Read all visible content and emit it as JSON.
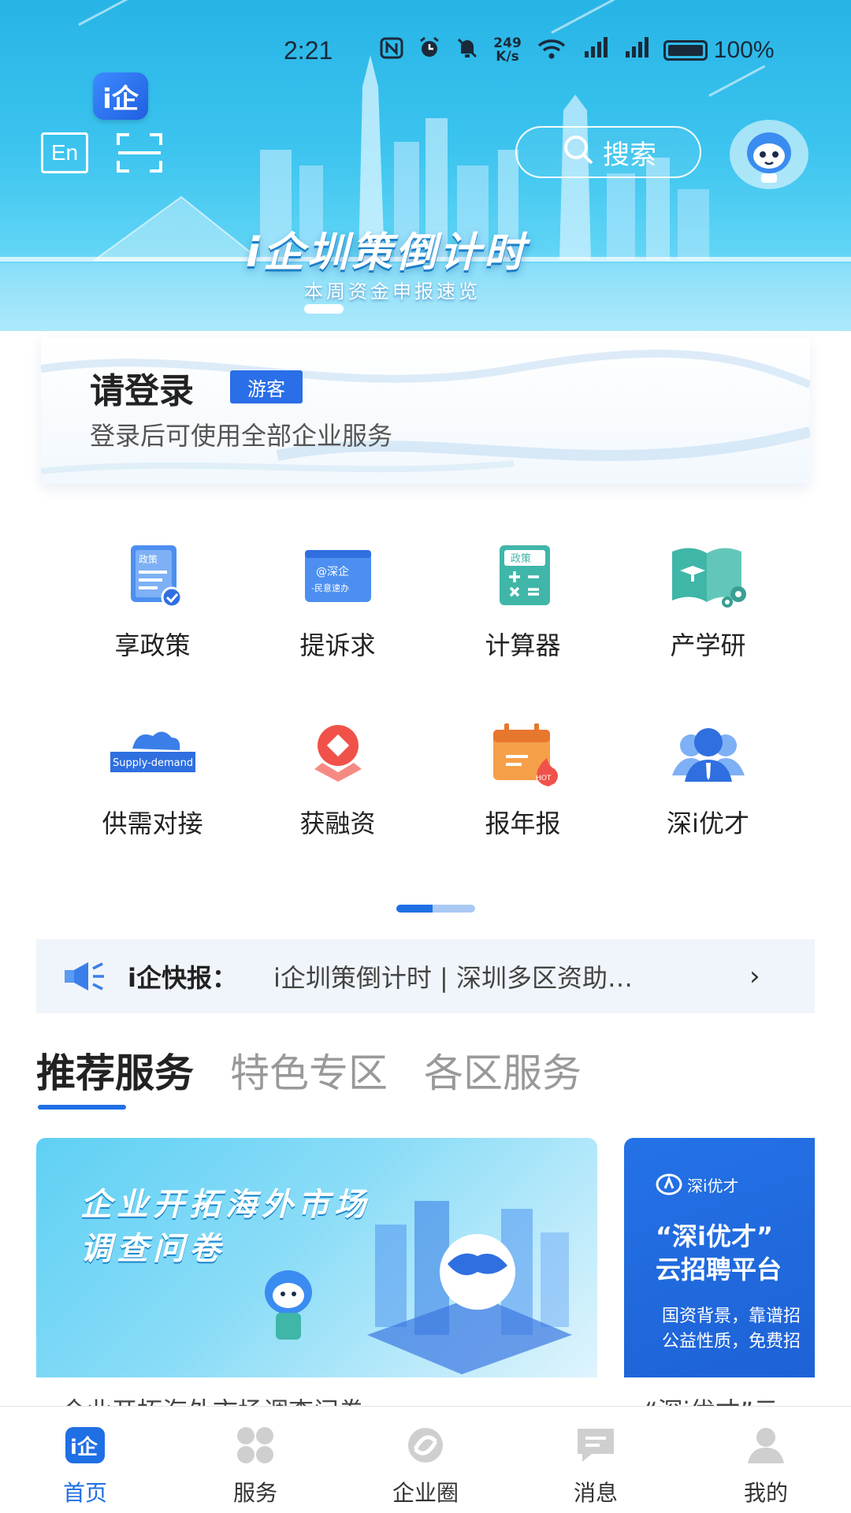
{
  "status_bar": {
    "time": "2:21",
    "net_speed_value": "249",
    "net_speed_unit": "K/s",
    "battery": "100%",
    "icons": [
      "nfc-icon",
      "alarm-icon",
      "mute-icon",
      "wifi-icon",
      "signal-icon",
      "signal-icon",
      "battery-icon"
    ]
  },
  "header": {
    "logo_text": "i企",
    "lang_button": "En",
    "search_label": "搜索"
  },
  "banner": {
    "title": "i企圳策倒计时",
    "subtitle": "本周资金申报速览"
  },
  "login_card": {
    "title": "请登录",
    "badge": "游客",
    "subtitle": "登录后可使用全部企业服务"
  },
  "services": [
    {
      "label": "享政策",
      "icon": "policy-doc-icon"
    },
    {
      "label": "提诉求",
      "icon": "appeal-icon"
    },
    {
      "label": "计算器",
      "icon": "calculator-icon"
    },
    {
      "label": "产学研",
      "icon": "book-gear-icon"
    },
    {
      "label": "供需对接",
      "icon": "supply-demand-icon"
    },
    {
      "label": "获融资",
      "icon": "financing-icon"
    },
    {
      "label": "报年报",
      "icon": "annual-report-icon"
    },
    {
      "label": "深i优才",
      "icon": "talent-icon"
    }
  ],
  "service_icon_text": {
    "policy": "政策",
    "appeal_top": "@深企",
    "appeal_bottom": "-民意速办",
    "calc": "政策",
    "supply": "Supply-demand",
    "hot": "HOT"
  },
  "ticker": {
    "label": "i企快报：",
    "text": "i企圳策倒计时 | 深圳多区资助…"
  },
  "tabs": [
    {
      "label": "推荐服务",
      "active": true
    },
    {
      "label": "特色专区",
      "active": false
    },
    {
      "label": "各区服务",
      "active": false
    }
  ],
  "cards": [
    {
      "title_line1": "企业开拓海外市场",
      "title_line2": "调查问卷",
      "caption": "企业开拓海外市场调查问卷"
    },
    {
      "brand": "深i优才",
      "title_line1": "“深i优才”",
      "title_line2": "云招聘平台",
      "desc_line1": "国资背景，靠谱招",
      "desc_line2": "公益性质，免费招",
      "caption": "“深i优才”云"
    }
  ],
  "bottom_nav": [
    {
      "label": "首页",
      "icon": "home-icon",
      "active": true
    },
    {
      "label": "服务",
      "icon": "services-grid-icon",
      "active": false
    },
    {
      "label": "企业圈",
      "icon": "circle-icon",
      "active": false
    },
    {
      "label": "消息",
      "icon": "message-icon",
      "active": false
    },
    {
      "label": "我的",
      "icon": "profile-icon",
      "active": false
    }
  ],
  "colors": {
    "accent": "#1f6fe5",
    "banner_top": "#27b4e6",
    "ticker_bg": "#f0f5fb"
  }
}
